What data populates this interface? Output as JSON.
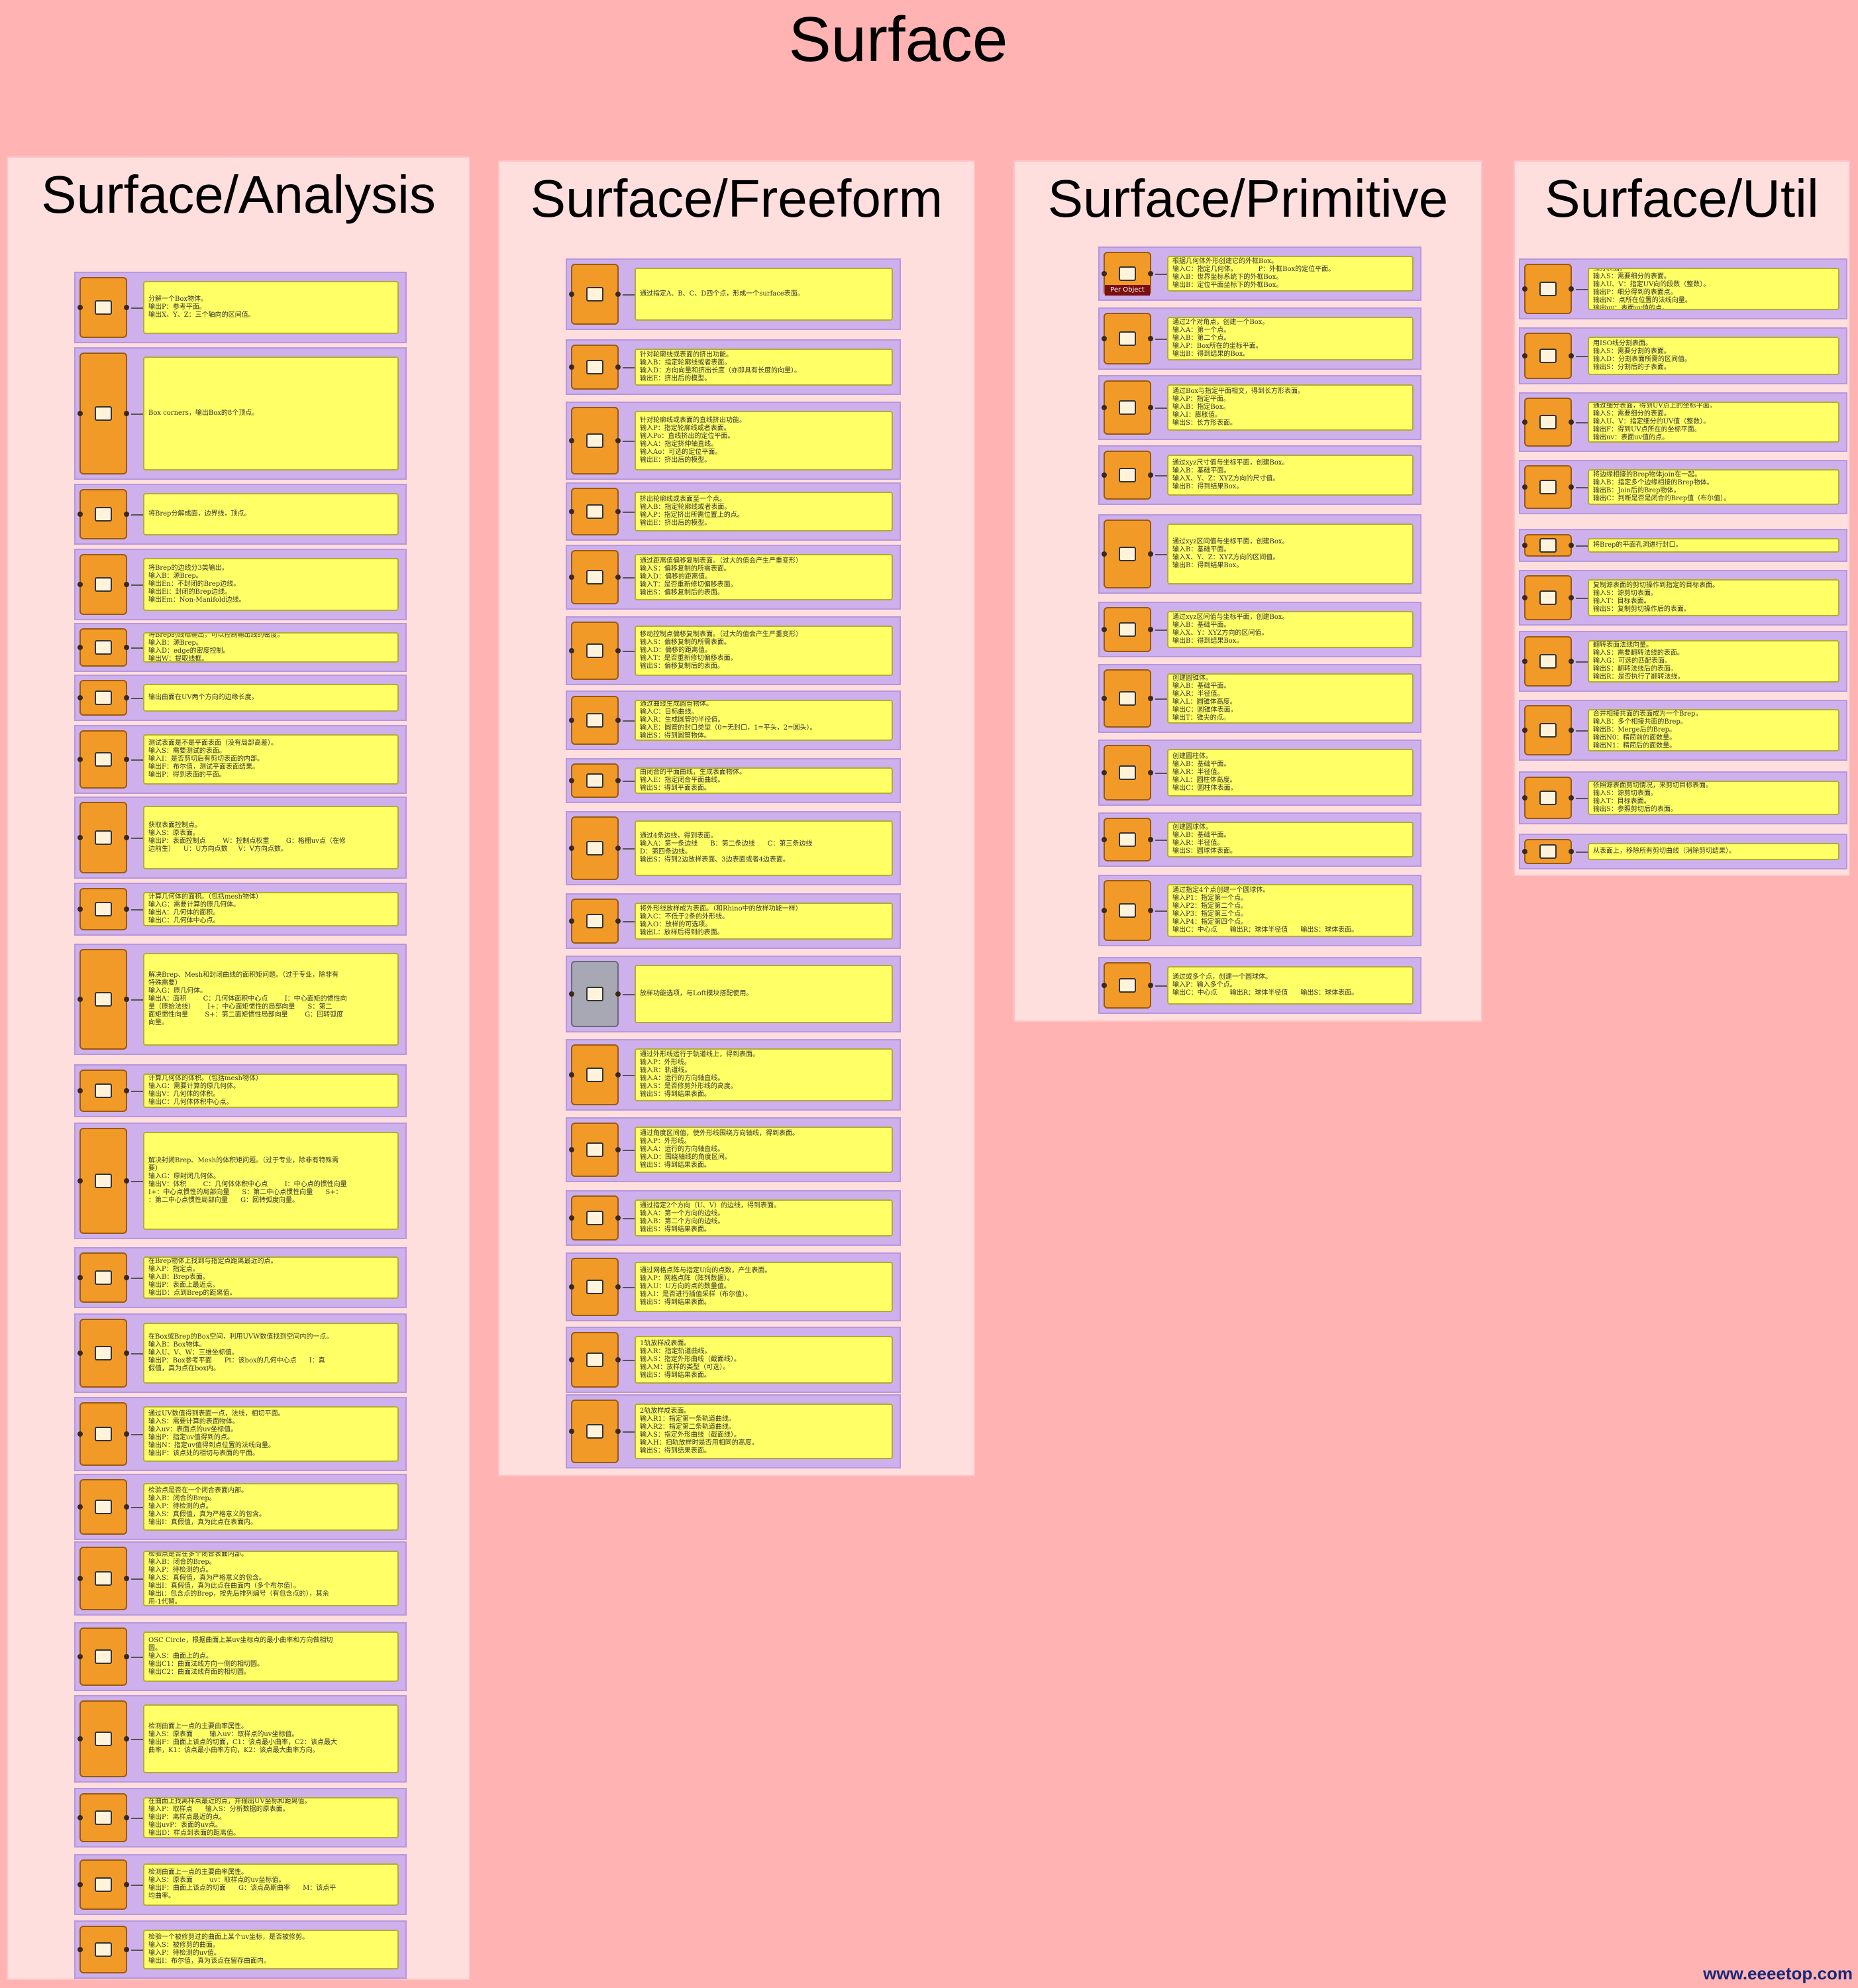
{
  "title": "Surface",
  "watermark": "www.eeeetop.com",
  "panels": [
    {
      "title": "Surface/Analysis",
      "components": [
        {
          "desc": "分解一个Box物体。\n输出P：参考平面。\n输出X、Y、Z：三个轴向的区间值。"
        },
        {
          "desc": "Box corners，输出Box的8个顶点。"
        },
        {
          "desc": "将Brep分解成面，边界线，顶点。"
        },
        {
          "desc": "将Brep的边线分3类输出。\n输入B：源Brep。\n输出En：不封闭的Brep边线。\n输出Ei：封闭的Brep边线。\n输出Em：Non-Manifold边线。"
        },
        {
          "desc": "将Brep的线框输出，可以控制输出线的密度。\n输入B：源Brep。\n输入D：edge的密度控制。\n输出W：提取线框。"
        },
        {
          "desc": "输出曲面在UV两个方向的边缘长度。"
        },
        {
          "desc": "测试表面是不是平面表面（没有局部高差）。\n输入S：需要测试的表面。\n输入I：是否剪切后有剪切表面的内部。\n输出F：布尔值，测试平面表面结果。\n输出P：得到表面的平面。"
        },
        {
          "desc": "获取表面控制点。\n输入S：原表面。\n输出P：表面控制点        W：控制点权重        G：格栅uv点（在修\n边前生）    U：U方向点数     V：V方向点数。"
        },
        {
          "desc": "计算几何体的面积。（包括mesh物体）\n输入G：需要计算的原几何体。\n输出A：几何体的面积。\n输出C：几何体中心点。"
        },
        {
          "desc": "解决Brep、Mesh和封闭曲线的面积矩问题。（过于专业，除非有\n特殊需要）\n输入G：原几何体。\n输出A：面积        C：几何体面积中心点        I：中心面矩的惯性向\n量（原始法线）      I+：中心面矩惯性的局部向量      S：第二\n面矩惯性向量        S+：第二面矩惯性局部向量        G：回转弧度\n向量。"
        },
        {
          "desc": "计算几何体的体积。（包括mesh物体）\n输入G：需要计算的原几何体。\n输出V：几何体的体积。\n输出C：几何体体积中心点。"
        },
        {
          "desc": "解决封闭Brep、Mesh的体积矩问题。（过于专业，除非有特殊需\n要）\n输入G：原封闭几何体。\n输出V：体积        C：几何体体积中心点        I：中心点的惯性向量\nI+：中心点惯性的局部向量      S：第二中心点惯性向量      S+：\n：第二中心点惯性局部向量      G：回转弧度向量。"
        },
        {
          "desc": "在Brep物体上找到与指定点距离最近的点。\n输入P：指定点。\n输入B：Brep表面。\n输出P：表面上最近点。\n输出D：点到Brep的距离值。"
        },
        {
          "desc": "在Box或Brep的Box空间，利用UVW数值找到空间内的一点。\n输入B：Box物体。\n输入U、V、W：三维坐标值。\n输出P：Box参考平面      Pt：该box的几何中心点      I：真\n假值，真为点在box内。"
        },
        {
          "desc": "通过UV数值得到表面一点，法线，相切平面。\n输入S：需要计算的表面物体。\n输入uv：表面点的uv坐标值。\n输出P：指定uv值得到的点。\n输出N：指定uv值得到点位置的法线向量。\n输出F：该点处的相切与表面的平面。"
        },
        {
          "desc": "检验点是否在一个闭合表面内部。\n输入B：闭合的Brep。\n输入P：待检测的点。\n输入S：真假值，真为严格意义的包含。\n输出I：真假值，真为此点在表面内。"
        },
        {
          "desc": "检验点是否在多个闭合表面内部。\n输入B：闭合的Brep。\n输入P：待检测的点。\n输入S：真假值，真为严格意义的包含。\n输出I：真假值，真为此点在曲面内（多个布尔值）。\n输出i：包含点的Brep，按先后排列编号（有包含点的），其余\n用-1代替。"
        },
        {
          "desc": "OSC Circle，根据曲面上某uv坐标点的最小曲率和方向做相切\n圆。\n输入S：曲面上的点。\n输出C1：曲面法线方向一侧的相切圆。\n输出C2：曲面法线背面的相切圆。"
        },
        {
          "desc": "检测曲面上一点的主要曲率属性。\n输入S：原表面        输入uv：取样点的uv坐标值。\n输出F：曲面上该点的切面，C1：该点最小曲率，C2：该点最大\n曲率，K1：该点最小曲率方向，K2：该点最大曲率方向。"
        },
        {
          "desc": "在曲面上找离样点最近的点，并输出UV坐标和距离值。\n输入P：取样点      输入S：分析数据的原表面。\n输出P：离样点最近的点。\n输出uvP：表面的uv点。\n输出D：样点到表面的距离值。"
        },
        {
          "desc": "检测曲面上一点的主要曲率属性。\n输入S：原表面        uv：取样点的uv坐标值。\n输出F：曲面上该点的切面      G：该点高斯曲率      M：该点平\n均曲率。"
        },
        {
          "desc": "检验一个被修剪过的曲面上某个uv坐标，是否被修剪。\n输入S：被修剪的曲面。\n输入P：待检测的uv值。\n输出I：布尔值，真为该点在留存曲面内。"
        }
      ]
    },
    {
      "title": "Surface/Freeform",
      "components": [
        {
          "desc": "通过指定A、B、C、D四个点，形成一个surface表面。"
        },
        {
          "desc": "针对轮廓线或表面的挤出功能。\n输入B：指定轮廓线或者表面。\n输入D：方向向量和挤出长度（亦即具有长度的向量）。\n输出E：挤出后的模型。"
        },
        {
          "desc": "针对轮廓线或表面的直线挤出功能。\n输入P：指定轮廓线或者表面。\n输入Po：直线挤出的定位平面。\n输入A：指定挤伸轴直线。\n输入Ao：可选的定位平面。\n输出E：挤出后的模型。"
        },
        {
          "desc": "挤出轮廓线或表面至一个点。\n输入B：指定轮廓线或者表面。\n输入P：指定挤出所需位置上的点。\n输出E：挤出后的模型。"
        },
        {
          "desc": "通过距离值偏移复制表面。（过大的值会产生严重变形）\n输入S：偏移复制的所需表面。\n输入D：偏移的距离值。\n输入T：是否重新修切偏移表面。\n输出S：偏移复制后的表面。"
        },
        {
          "desc": "移动控制点偏移复制表面。（过大的值会产生严重变形）\n输入S：偏移复制的所需表面。\n输入D：偏移的距离值。\n输入T：是否重新修切偏移表面。\n输出S：偏移复制后的表面。"
        },
        {
          "desc": "通过曲线生成圆管物体。\n输入C：目标曲线。\n输入R：生成圆管的半径值。\n输入E：圆管的封口类型（0=无封口，1=平头，2=圆头）。\n输出S：得到圆管物体。"
        },
        {
          "desc": "由闭合的平面曲线，生成表面物体。\n输入E：指定闭合平面曲线。\n输出S：得到平面表面。"
        },
        {
          "desc": "通过4条边线，得到表面。\n输入A：第一条边线      B：第二条边线      C：第三条边线\nD：第四条边线。\n输出S：得到2边放样表面、3边表面或者4边表面。"
        },
        {
          "desc": "将外形线放样成为表面。（和Rhino中的放样功能一样）\n输入C：不低于2条的外形线。\n输入O：放样的可选项。\n输出L：放样后得到的表面。"
        },
        {
          "desc": "放样功能选项，与Loft模块搭配使用。"
        },
        {
          "desc": "通过外形线运行于轨道线上，得到表面。\n输入P：外形线。\n输入R：轨道线。\n输入A：运行的方向轴直线。\n输入S：是否修剪外形线的高度。\n输出S：得到结果表面。"
        },
        {
          "desc": "通过角度区间值，使外形线围绕方向轴线，得到表面。\n输入P：外形线。\n输入A：运行的方向轴直线。\n输入D：围绕轴线的角度区间。\n输出S：得到结果表面。"
        },
        {
          "desc": "通过指定2个方向（U、V）的边线，得到表面。\n输入A：第一个方向的边线。\n输入B：第二个方向的边线。\n输出S：得到结果表面。"
        },
        {
          "desc": "通过网格点阵与指定U向的点数，产生表面。\n输入P：网格点阵（阵列数据）。\n输入U：U方向的点的数量值。\n输入I：是否进行插值采样（布尔值）。\n输出S：得到结果表面。"
        },
        {
          "desc": "1轨放样成表面。\n输入R：指定轨道曲线。\n输入S：指定外形曲线（截面线）。\n输入M：放样的类型（可选）。\n输出S：得到结果表面。"
        },
        {
          "desc": "2轨放样成表面。\n输入R1：指定第一条轨道曲线。\n输入R2：指定第二条轨道曲线。\n输入S：指定外形曲线（截面线）。\n输入H：扫轨放样时是否用相同的高度。\n输出S：得到结果表面。"
        }
      ]
    },
    {
      "title": "Surface/Primitive",
      "components": [
        {
          "desc": "根据几何体外形创建它的外框Box。\n输入C：指定几何体。          P：外框Box的定位平面。\n输入B：世界坐标系统下的外框Box。\n输出B：定位平面坐标下的外框Box。",
          "tag": "Per Object"
        },
        {
          "desc": "通过2个对角点，创建一个Box。\n输入A：第一个点。\n输入B：第二个点。\n输入P：Box所在的坐标平面。\n输出B：得到结果的Box。"
        },
        {
          "desc": "通过Box与指定平面相交，得到长方形表面。\n输入P：指定平面。\n输入B：指定Box。\n输入I：膨胀值。\n输出S：长方形表面。"
        },
        {
          "desc": "通过xyz尺寸值与坐标平面，创建Box。\n输入B：基础平面。\n输入X、Y、Z：XYZ方向的尺寸值。\n输出B：得到结果Box。"
        },
        {
          "desc": "通过xyz区间值与坐标平面，创建Box。\n输入B：基础平面。\n输入X、Y、Z：XYZ方向的区间值。\n输出B：得到结果Box。"
        },
        {
          "desc": "通过xyz区间值与坐标平面，创建Box。\n输入B：基础平面。\n输入X、Y：XYZ方向的区间值。\n输出B：得到结果Box。"
        },
        {
          "desc": "创建圆锥体。\n输入B：基础平面。\n输入R：半径值。\n输入L：圆锥体高度。\n输出C：圆锥体表面。\n输出T：锥尖的点。"
        },
        {
          "desc": "创建圆柱体。\n输入B：基础平面。\n输入R：半径值。\n输入L：圆柱体高度。\n输出C：圆柱体表面。"
        },
        {
          "desc": "创建圆球体。\n输入B：基础平面。\n输入R：半径值。\n输出S：圆球体表面。"
        },
        {
          "desc": "通过指定4个点创建一个圆球体。\n输入P1：指定第一个点。\n输入P2：指定第二个点。\n输入P3：指定第三个点。\n输入P4：指定第四个点。\n输出C：中心点      输出R：球体半径值      输出S：球体表面。"
        },
        {
          "desc": "通过或多个点，创建一个圆球体。\n输入P：输入多个点。\n输出C：中心点      输出R：球体半径值      输出S：球体表面。"
        }
      ]
    },
    {
      "title": "Surface/Util",
      "components": [
        {
          "desc": "细分表面。\n输入S：需要细分的表面。\n输入U、V：指定UV向的段数（整数）。\n输出P：细分得到的表面点。\n输出N：点所在位置的法线向量。\n输出uv：表面uv值的点。"
        },
        {
          "desc": "用ISO线分割表面。\n输入S：需要分割的表面。\n输入D：分割表面所需的区间值。\n输出S：分割后的子表面。"
        },
        {
          "desc": "通过细分表面，得到UV点上的坐标平面。\n输入S：需要细分的表面。\n输入U、V：指定细分的UV值（整数）。\n输出F：得到UV点所在的坐标平面。\n输出uv：表面uv值的点。"
        },
        {
          "desc": "将边缘相接的Brep物体join在一起。\n输入B：指定多个边缘相接的Brep物体。\n输出B：Join后的Brep物体。\n输出C：判断是否是闭合的Brep值（布尔值）。"
        },
        {
          "desc": "将Brep的平面孔洞进行封口。"
        },
        {
          "desc": "复制源表面的剪切操作到指定的目标表面。\n输入S：源剪切表面。\n输入T：目标表面。\n输出S：复制剪切操作后的表面。"
        },
        {
          "desc": "翻转表面法线向量。\n输入S：需要翻转法线的表面。\n输入G：可选的匹配表面。\n输出S：翻转法线后的表面。\n输出R：是否执行了翻转法线。"
        },
        {
          "desc": "合并相接共面的表面成为一个Brep。\n输入B：多个相接共面的Brep。\n输出B：Merge后的Brep。\n输出N0：精简前的面数量。\n输出N1：精简后的面数量。"
        },
        {
          "desc": "依照源表面剪切情况，来剪切目标表面。\n输入S：源剪切表面。\n输入T：目标表面。\n输出S：参照剪切后的表面。"
        },
        {
          "desc": "从表面上，移除所有剪切曲线（消除剪切结果）。"
        }
      ]
    }
  ]
}
